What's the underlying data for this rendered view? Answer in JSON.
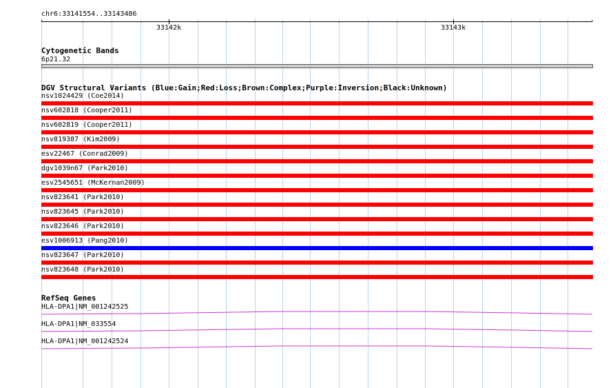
{
  "ruler": {
    "region": "chr6:33141554..33143486",
    "ticks": [
      "33142k",
      "33143k"
    ]
  },
  "cytoband": {
    "title": "Cytogenetic Bands",
    "band": "6p21.32",
    "color": "#cccccc"
  },
  "dgv": {
    "title": "DGV Structural Variants (Blue:Gain;Red:Loss;Brown:Complex;Purple:Inversion;Black:Unknown)",
    "variants": [
      {
        "label": "nsv1024429 (Coe2014)",
        "color": "#ff0000"
      },
      {
        "label": "nsv602818 (Cooper2011)",
        "color": "#ff0000"
      },
      {
        "label": "nsv602819 (Cooper2011)",
        "color": "#ff0000"
      },
      {
        "label": "nsv819387 (Kim2009)",
        "color": "#ff0000"
      },
      {
        "label": "esv22467 (Conrad2009)",
        "color": "#ff0000"
      },
      {
        "label": "dgv1039n67 (Park2010)",
        "color": "#ff0000"
      },
      {
        "label": "esv2545651 (McKernan2009)",
        "color": "#ff0000"
      },
      {
        "label": "nsv823641 (Park2010)",
        "color": "#ff0000"
      },
      {
        "label": "nsv823645 (Park2010)",
        "color": "#ff0000"
      },
      {
        "label": "nsv823646 (Park2010)",
        "color": "#ff0000"
      },
      {
        "label": "esv1006913 (Pang2010)",
        "color": "#0000ff"
      },
      {
        "label": "nsv823647 (Park2010)",
        "color": "#ff0000"
      },
      {
        "label": "nsv823648 (Park2010)",
        "color": "#ff0000"
      }
    ]
  },
  "refseq": {
    "title": "RefSeq Genes",
    "color": "#cc33cc",
    "genes": [
      {
        "label": "HLA-DPA1|NM_001242525"
      },
      {
        "label": "HLA-DPA1|NM_033554"
      },
      {
        "label": "HLA-DPA1|NM_001242524"
      }
    ]
  }
}
